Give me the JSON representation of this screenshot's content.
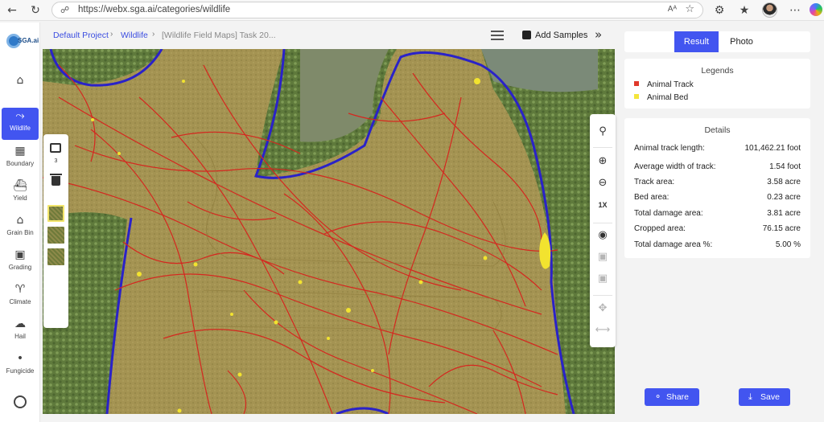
{
  "browser": {
    "url": "https://webx.sga.ai/categories/wildlife",
    "reader_label": "Aᴬ"
  },
  "logo_text": "SGA.ai",
  "nav": [
    {
      "label": "",
      "icon": "home-icon",
      "glyph": "⌂"
    },
    {
      "label": "Wildlife",
      "icon": "wildlife-icon",
      "glyph": "⤳"
    },
    {
      "label": "Boundary",
      "icon": "boundary-icon",
      "glyph": "▦"
    },
    {
      "label": "Yield",
      "icon": "yield-icon",
      "glyph": "⛴"
    },
    {
      "label": "Grain Bin",
      "icon": "grain-bin-icon",
      "glyph": "⌂"
    },
    {
      "label": "Grading",
      "icon": "grading-icon",
      "glyph": "▣"
    },
    {
      "label": "Climate",
      "icon": "climate-icon",
      "glyph": "♈"
    },
    {
      "label": "Hail",
      "icon": "hail-icon",
      "glyph": "☁"
    },
    {
      "label": "Fungicide",
      "icon": "fungicide-icon",
      "glyph": "•"
    }
  ],
  "breadcrumb": {
    "project": "Default Project",
    "category": "Wildlife",
    "task": "[Wildlife Field Maps] Task 20..."
  },
  "header": {
    "add_samples": "Add Samples",
    "collapse": "»"
  },
  "map_tools": {
    "image_count": "3",
    "zoom_level": "1X"
  },
  "tabs": {
    "result": "Result",
    "photo": "Photo"
  },
  "legends": {
    "title": "Legends",
    "items": [
      {
        "label": "Animal Track",
        "color": "#e0392b"
      },
      {
        "label": "Animal Bed",
        "color": "#f4e53a"
      }
    ]
  },
  "details": {
    "title": "Details",
    "rows": [
      {
        "label": "Animal track length:",
        "value": "101,462.21 foot"
      },
      {
        "label": "Average width of track:",
        "value": "1.54 foot"
      },
      {
        "label": "Track area:",
        "value": "3.58 acre"
      },
      {
        "label": "Bed area:",
        "value": "0.23 acre"
      },
      {
        "label": "Total damage area:",
        "value": "3.81 acre"
      },
      {
        "label": "Cropped area:",
        "value": "76.15 acre"
      },
      {
        "label": "Total damage area %:",
        "value": "5.00 %"
      }
    ]
  },
  "actions": {
    "share": "Share",
    "save": "Save"
  },
  "colors": {
    "accent": "#4255f0",
    "boundary": "#2a22c8",
    "track": "#d5271f",
    "bed": "#f2e32f"
  }
}
